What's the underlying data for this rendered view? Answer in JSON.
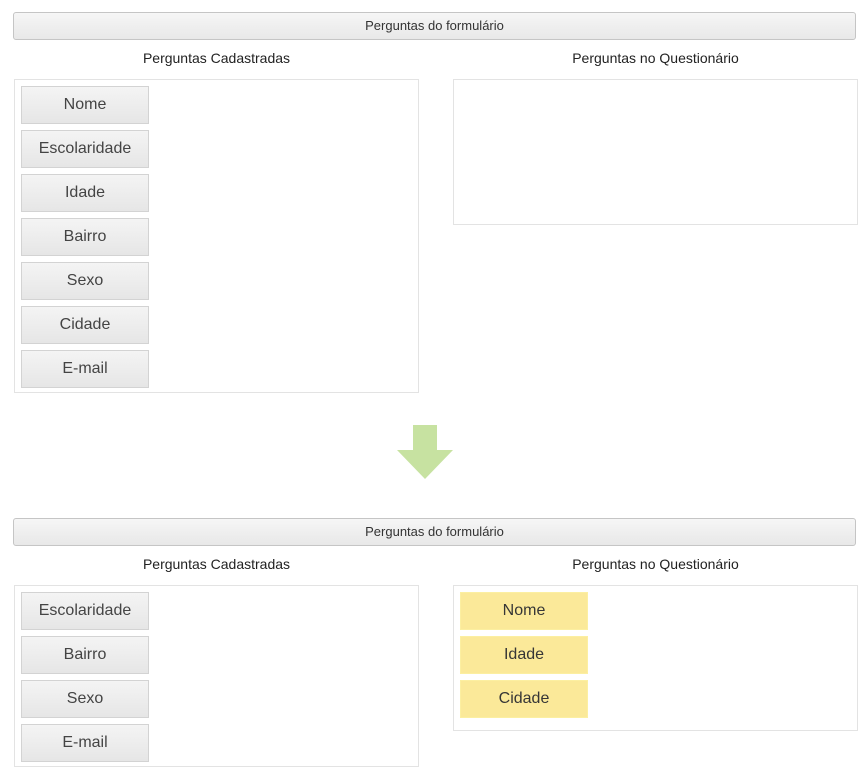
{
  "colors": {
    "available_item_bg": "#e9e9e9",
    "selected_item_bg": "#fbe999",
    "arrow": "#c7e2a1"
  },
  "before": {
    "header": "Perguntas do formulário",
    "left_title": "Perguntas Cadastradas",
    "right_title": "Perguntas no Questionário",
    "registered": [
      "Nome",
      "Escolaridade",
      "Idade",
      "Bairro",
      "Sexo",
      "Cidade",
      "E-mail"
    ],
    "selected": []
  },
  "transition_icon": "down-arrow-icon",
  "after": {
    "header": "Perguntas do formulário",
    "left_title": "Perguntas Cadastradas",
    "right_title": "Perguntas no Questionário",
    "registered": [
      "Escolaridade",
      "Bairro",
      "Sexo",
      "E-mail"
    ],
    "selected": [
      "Nome",
      "Idade",
      "Cidade"
    ]
  }
}
